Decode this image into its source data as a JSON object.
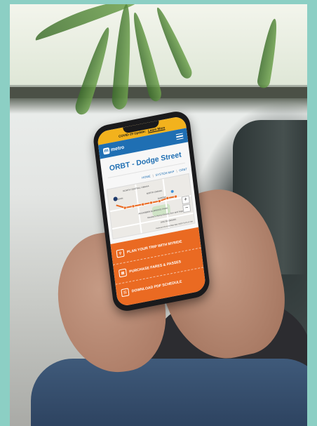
{
  "covid_banner": {
    "text": "COVID-19 Update:",
    "link": "Learn More"
  },
  "header": {
    "logo_text": "metro",
    "logo_mark": "m"
  },
  "page_title": "ORBT - Dodge Street",
  "breadcrumb": {
    "home": "HOME",
    "system_map": "SYSTEM MAP",
    "current": "ORBT"
  },
  "map": {
    "labels": [
      "NORTH CENTRAL OMAHA",
      "BENSON",
      "NORTH OMAHA",
      "DUNDEE",
      "AKSARBEN ELMWOOD PARK",
      "Omaha's Henry Doorly Zoo and Aquarium",
      "SOUTH OMAHA"
    ],
    "zoom_in": "+",
    "zoom_out": "−",
    "attribution": "Keyboard shortcuts   Map data ©2022   Terms of Use"
  },
  "actions": [
    {
      "icon": "location-pin-icon",
      "label": "PLAN YOUR TRIP WITH MYRIDE"
    },
    {
      "icon": "ticket-icon",
      "label": "PURCHASE FARES & PASSES"
    },
    {
      "icon": "document-icon",
      "label": "DOWNLOAD PDF SCHEDULE"
    }
  ],
  "colors": {
    "brand_blue": "#1f6fb3",
    "banner_yellow": "#f2b21d",
    "cta_orange": "#ea6a22",
    "frame_teal": "#8ccfc4"
  }
}
